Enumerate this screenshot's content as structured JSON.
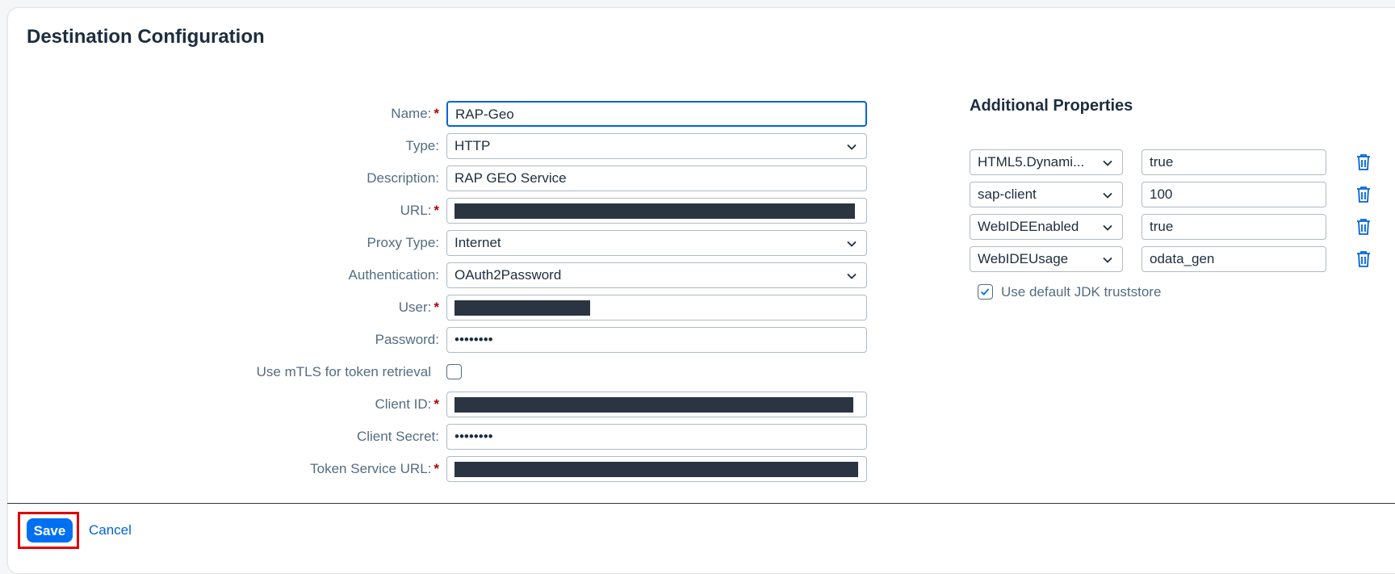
{
  "page": {
    "title": "Destination Configuration"
  },
  "form": {
    "name": {
      "label": "Name:",
      "value": "RAP-Geo",
      "required": true
    },
    "type": {
      "label": "Type:",
      "value": "HTTP"
    },
    "description": {
      "label": "Description:",
      "value": "RAP GEO Service"
    },
    "url": {
      "label": "URL:",
      "required": true
    },
    "proxy_type": {
      "label": "Proxy Type:",
      "value": "Internet"
    },
    "authentication": {
      "label": "Authentication:",
      "value": "OAuth2Password"
    },
    "user": {
      "label": "User:",
      "required": true
    },
    "password": {
      "label": "Password:",
      "value": "••••••••"
    },
    "mtls": {
      "label": "Use mTLS for token retrieval",
      "checked": false
    },
    "client_id": {
      "label": "Client ID:",
      "required": true
    },
    "client_secret": {
      "label": "Client Secret:",
      "value": "••••••••"
    },
    "token_service_url": {
      "label": "Token Service URL:",
      "required": true
    },
    "required_marker": "*"
  },
  "additional": {
    "title": "Additional Properties",
    "properties": [
      {
        "key": "HTML5.Dynami...",
        "value": "true"
      },
      {
        "key": "sap-client",
        "value": "100"
      },
      {
        "key": "WebIDEEnabled",
        "value": "true"
      },
      {
        "key": "WebIDEUsage",
        "value": "odata_gen"
      }
    ],
    "jdk_truststore": {
      "label": "Use default JDK truststore",
      "checked": true
    }
  },
  "footer": {
    "save_label": "Save",
    "cancel_label": "Cancel"
  },
  "colors": {
    "accent": "#0070f2",
    "required": "#aa0808",
    "highlight": "#e00000"
  }
}
